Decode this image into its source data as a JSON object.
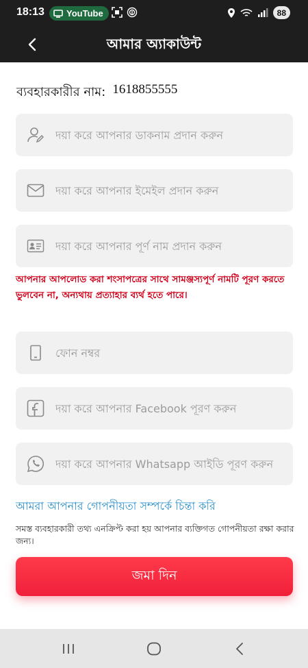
{
  "status_bar": {
    "time": "18:13",
    "youtube_label": "YouTube",
    "battery": "88"
  },
  "header": {
    "title": "আমার অ্যাকাউন্ট"
  },
  "account": {
    "username_label": "ব্যবহারকারীর নাম:",
    "username_value": "1618855555"
  },
  "fields": {
    "nickname": {
      "placeholder": "দয়া করে আপনার ডাকনাম প্রদান করুন",
      "icon": "user-edit-icon"
    },
    "email": {
      "placeholder": "দয়া করে আপনার ইমেইল প্রদান করুন",
      "icon": "mail-icon"
    },
    "fullname": {
      "placeholder": "দয়া করে আপনার পূর্ণ নাম প্রদান করুন",
      "icon": "id-card-icon"
    },
    "phone": {
      "placeholder": "ফোন নম্বর",
      "icon": "phone-icon"
    },
    "facebook": {
      "placeholder": "দয়া করে আপনার Facebook পূরণ করুন",
      "icon": "facebook-icon"
    },
    "whatsapp": {
      "placeholder": "দয়া করে আপনার Whatsapp আইডি পূরণ করুন",
      "icon": "whatsapp-icon"
    }
  },
  "warning_text": "আপনার আপলোড করা শংসাপত্রের সাথে সামঞ্জস্যপূর্ণ নামটি পূরণ করতে ভুলবেন না, অন্যথায় প্রত্যাহার ব্যর্থ হতে পারে।",
  "privacy": {
    "link": "আমরা আপনার গোপনীয়তা সম্পর্কে চিন্তা করি",
    "note": "সমস্ত ব্যবহারকারী তথ্য এনক্রিপ্ট করা হয় আপনার ব্যক্তিগত গোপনীয়তা রক্ষা করার জন্য।"
  },
  "submit_label": "জমা দিন",
  "colors": {
    "accent": "#f0203a",
    "warning": "#d0021b",
    "link": "#2a8fc9",
    "header_bg": "#1e1e1e"
  }
}
